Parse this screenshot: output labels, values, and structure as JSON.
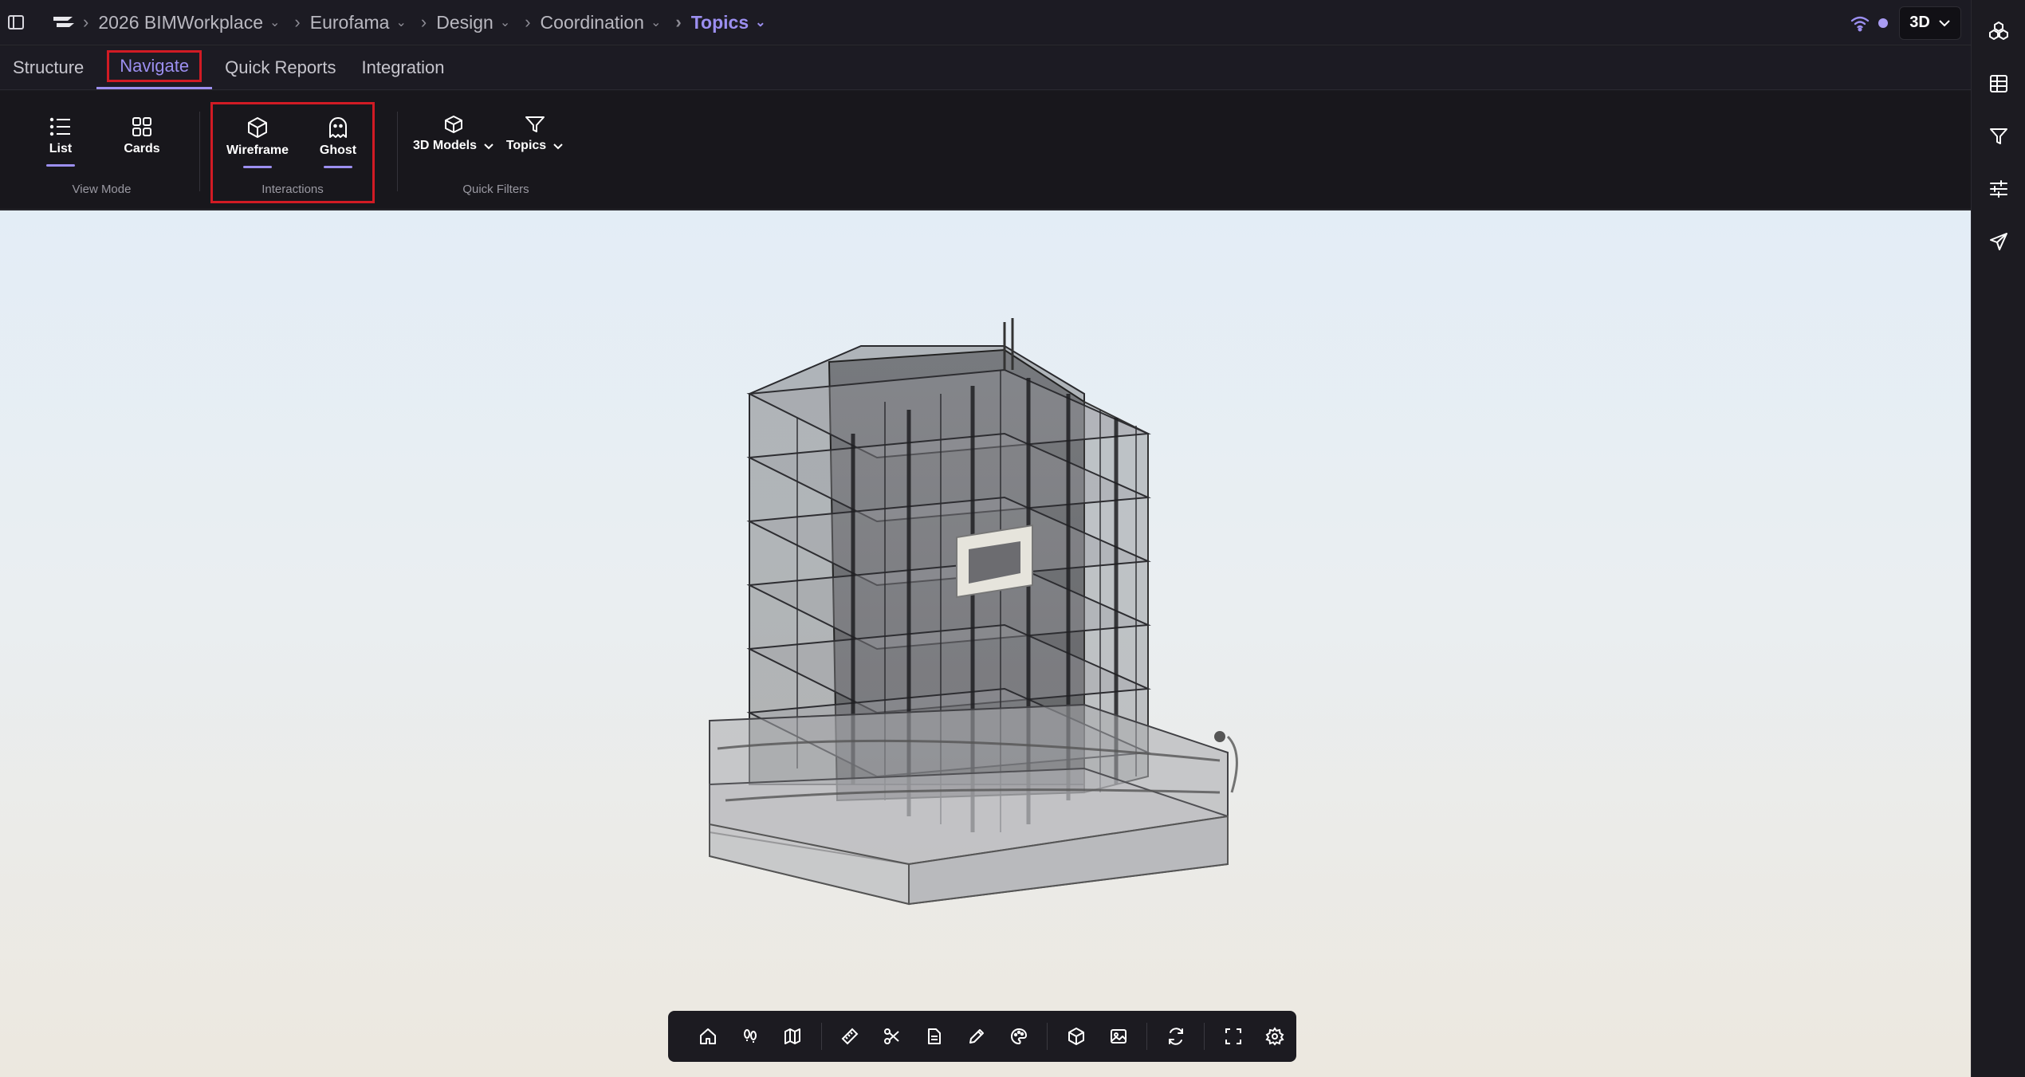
{
  "header": {
    "breadcrumbs": [
      {
        "label": "2026 BIMWorkplace"
      },
      {
        "label": "Eurofama"
      },
      {
        "label": "Design"
      },
      {
        "label": "Coordination"
      },
      {
        "label": "Topics"
      }
    ],
    "view_mode": "3D",
    "status_color": "#a99cf2"
  },
  "tabs": [
    {
      "label": "Structure"
    },
    {
      "label": "Navigate"
    },
    {
      "label": "Quick Reports"
    },
    {
      "label": "Integration"
    }
  ],
  "ribbon": {
    "view_mode": {
      "label": "View Mode",
      "list": "List",
      "cards": "Cards"
    },
    "interactions": {
      "label": "Interactions",
      "wireframe": "Wireframe",
      "ghost": "Ghost"
    },
    "quick_filters": {
      "label": "Quick Filters",
      "models": "3D Models",
      "topics": "Topics"
    }
  },
  "colors": {
    "accent": "#9c8ff0",
    "highlight": "#d11b24",
    "panel": "#1c1b23"
  },
  "viewer_toolbar": {
    "icons": [
      "home-icon",
      "walk-icon",
      "map-icon",
      "measure-icon",
      "cut-icon",
      "document-icon",
      "pencil-icon",
      "palette-icon",
      "cube-icon",
      "image-icon",
      "refresh-icon",
      "fullscreen-icon",
      "settings-icon"
    ]
  },
  "right_rail": {
    "icons": [
      "models-icon",
      "table-icon",
      "filter-icon",
      "sliders-icon",
      "send-icon"
    ]
  }
}
